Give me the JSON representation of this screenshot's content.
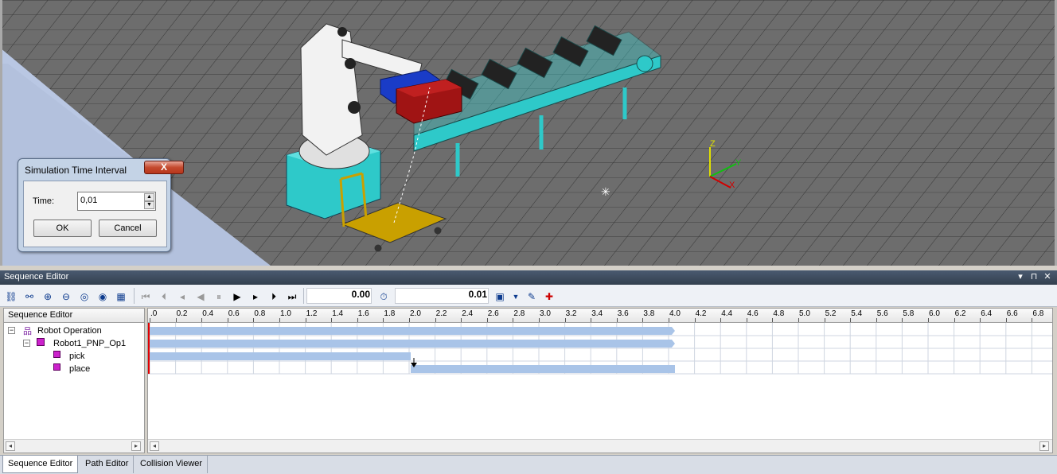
{
  "dialog": {
    "title": "Simulation Time Interval",
    "close_label": "X",
    "time_label": "Time:",
    "time_value": "0,01",
    "ok_label": "OK",
    "cancel_label": "Cancel"
  },
  "viewport": {
    "axis_labels": {
      "z": "Z",
      "y": "Y",
      "x": "X"
    }
  },
  "sequence_editor": {
    "title": "Sequence Editor",
    "toolbar": {
      "current_time": "0.00",
      "interval": "0.01"
    },
    "tree_header": "Sequence Editor",
    "tree": [
      {
        "label": "Robot Operation"
      },
      {
        "label": "Robot1_PNP_Op1"
      },
      {
        "label": "pick"
      },
      {
        "label": "place"
      }
    ],
    "ruler_ticks": [
      ".0",
      "0.2",
      "0.4",
      "0.6",
      "0.8",
      "1.0",
      "1.2",
      "1.4",
      "1.6",
      "1.8",
      "2.0",
      "2.2",
      "2.4",
      "2.6",
      "2.8",
      "3.0",
      "3.2",
      "3.4",
      "3.6",
      "3.8",
      "4.0",
      "4.2",
      "4.4",
      "4.6",
      "4.8",
      "5.0",
      "5.2",
      "5.4",
      "5.6",
      "5.8",
      "6.0",
      "6.2",
      "6.4",
      "6.6",
      "6.8"
    ]
  },
  "tabs": [
    {
      "label": "Sequence Editor"
    },
    {
      "label": "Path Editor"
    },
    {
      "label": "Collision Viewer"
    }
  ]
}
